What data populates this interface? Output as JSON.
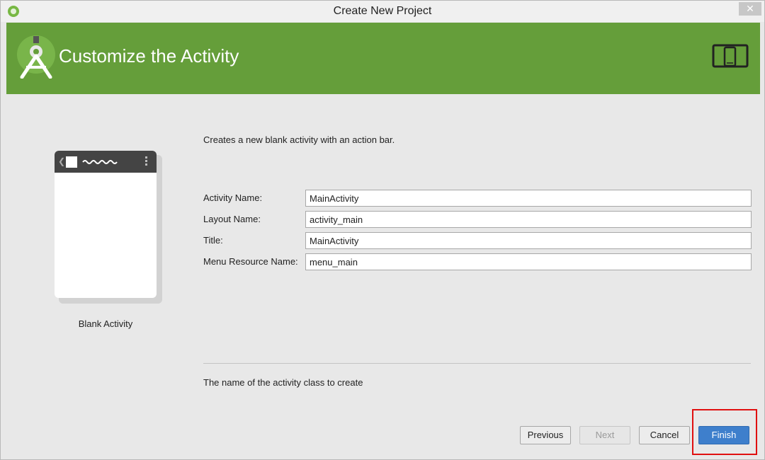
{
  "window": {
    "title": "Create New Project",
    "close_glyph": "✕"
  },
  "banner": {
    "title": "Customize the Activity",
    "logo_icon": "android-studio-logo-icon",
    "device_icon": "phone-tablet-icon"
  },
  "template": {
    "name": "Blank Activity"
  },
  "description": "Creates a new blank activity with an action bar.",
  "form": {
    "fields": [
      {
        "label": "Activity Name:",
        "value": "MainActivity"
      },
      {
        "label": "Layout Name:",
        "value": "activity_main"
      },
      {
        "label": "Title:",
        "value": "MainActivity"
      },
      {
        "label": "Menu Resource Name:",
        "value": "menu_main"
      }
    ]
  },
  "help_text": "The name of the activity class to create",
  "buttons": {
    "previous": "Previous",
    "next": "Next",
    "cancel": "Cancel",
    "finish": "Finish"
  },
  "colors": {
    "banner": "#659e3a",
    "primary": "#3e7fcc",
    "highlight": "#e01010"
  }
}
